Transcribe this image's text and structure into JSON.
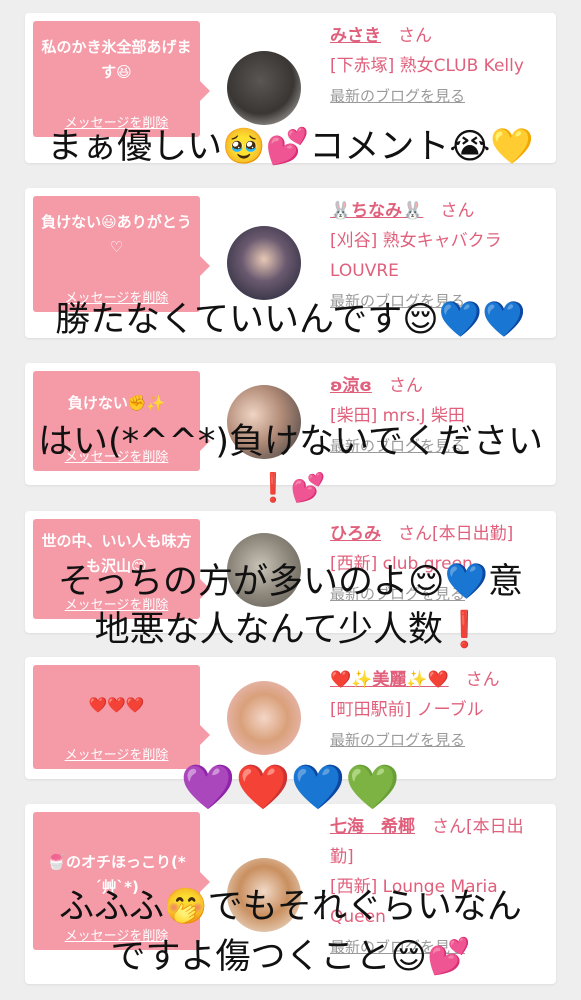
{
  "cards": [
    {
      "message": "私のかき氷全部あげます😆",
      "delete_label": "メッセージを削除",
      "name": "みさき",
      "san": "さん",
      "shop": "[下赤塚] 熟女CLUB Kelly",
      "blog": "最新のブログを見る"
    },
    {
      "message": "負けない😃ありがとう♡",
      "delete_label": "メッセージを削除",
      "name": "🐰ちなみ🐰",
      "san": "さん",
      "shop": "[刈谷] 熟女キャバクラ LOUVRE",
      "blog": "最新のブログを見る"
    },
    {
      "message": "負けない✊✨",
      "delete_label": "メッセージを削除",
      "name": "ʚ涼ɞ",
      "san": "さん",
      "shop": "[柴田] mrs.J 柴田",
      "blog": "最新のブログを見る"
    },
    {
      "message": "世の中、いい人も味方も沢山😊",
      "delete_label": "メッセージを削除",
      "name": "ひろみ",
      "san": "さん[本日出勤]",
      "shop": "[西新] club green",
      "blog": "最新のブログを見る"
    },
    {
      "message": "❤️❤️❤️",
      "delete_label": "メッセージを削除",
      "name": "❤️✨美麗✨❤️",
      "san": "さん",
      "shop": "[町田駅前] ノーブル",
      "blog": "最新のブログを見る"
    },
    {
      "message": "🍧のオチほっこり(*´艸`*)",
      "delete_label": "メッセージを削除",
      "name": "七海　希椰",
      "san": "さん[本日出勤]",
      "shop": "[西新] Lounge Maria Queen",
      "blog": "最新のブログを見る"
    }
  ],
  "overlays": [
    "まぁ優しい🥹💕コメント😭💛",
    "勝たなくていいんです😌💙💙",
    "はい(*^^*)負けないでください",
    "❗💕",
    "そっちの方が多いのよ😌💙意",
    "地悪な人なんて少人数❗",
    "💜❤️💙💚",
    "ふふふ🤭でもそれぐらいなん",
    "ですよ傷つくこと😌💕"
  ]
}
